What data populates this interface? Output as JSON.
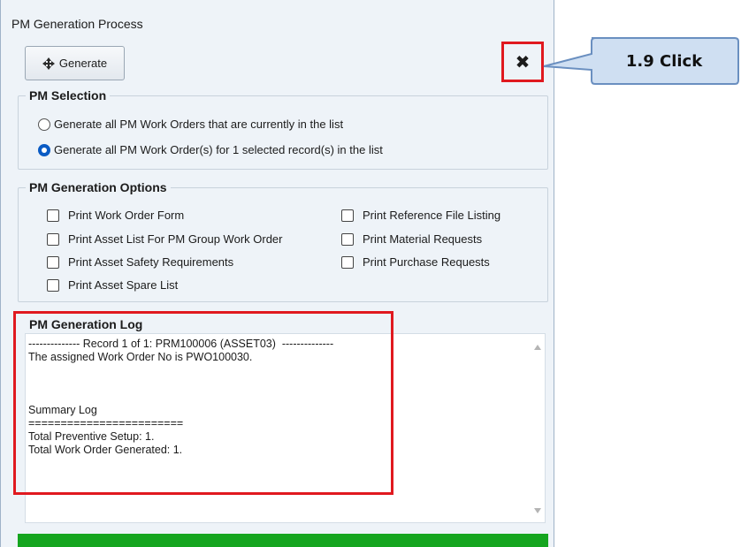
{
  "window": {
    "title": "PM Generation Process"
  },
  "toolbar": {
    "generate_label": "Generate",
    "generate_icon": "crosshair-arrows-icon",
    "close_icon": "close-icon",
    "close_glyph": "✖"
  },
  "pm_selection": {
    "title": "PM Selection",
    "options": [
      {
        "label": "Generate all PM Work Orders that are currently in the list",
        "selected": false
      },
      {
        "label": "Generate all PM Work Order(s) for 1 selected record(s) in the list",
        "selected": true
      }
    ]
  },
  "pm_options": {
    "title": "PM Generation Options",
    "left": [
      "Print Work Order Form",
      "Print Asset List For PM Group Work Order",
      "Print Asset Safety Requirements",
      "Print Asset Spare List"
    ],
    "right": [
      "Print Reference File Listing",
      "Print Material Requests",
      "Print Purchase Requests"
    ]
  },
  "log": {
    "title": "PM Generation Log",
    "lines": [
      "-------------- Record 1 of 1: PRM100006 (ASSET03)  --------------",
      "The assigned Work Order No is PWO100030.",
      "",
      "",
      "",
      "Summary Log",
      "========================",
      "Total Preventive Setup: 1.",
      "Total Work Order Generated: 1."
    ]
  },
  "progress": {
    "percent": 100,
    "color": "#15a51f"
  },
  "annotation": {
    "callout_text": "1.9 Click",
    "highlight_color": "#e0191f",
    "callout_fill": "#cfdff2",
    "callout_border": "#6a8fc0"
  }
}
